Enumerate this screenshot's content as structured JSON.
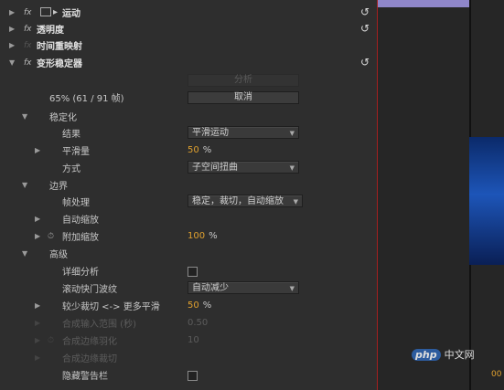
{
  "effects": {
    "motion": {
      "label": "运动"
    },
    "opacity": {
      "label": "透明度"
    },
    "time_remap": {
      "label": "时间重映射"
    },
    "warp": {
      "label": "变形稳定器"
    }
  },
  "warp": {
    "analyze_label": "分析",
    "status_text": "65% (61 / 91 帧)",
    "cancel_label": "取消",
    "stabilization": {
      "label": "稳定化",
      "result_label": "结果",
      "result_value": "平滑运动",
      "smoothness_label": "平滑量",
      "smoothness_value": "50",
      "smoothness_unit": "%",
      "method_label": "方式",
      "method_value": "子空间扭曲"
    },
    "borders": {
      "label": "边界",
      "framing_label": "帧处理",
      "framing_value": "稳定，裁切，自动缩放",
      "auto_scale_label": "自动缩放",
      "additional_scale_label": "附加缩放",
      "additional_scale_value": "100",
      "additional_scale_unit": "%"
    },
    "advanced": {
      "label": "高级",
      "detailed_analysis_label": "详细分析",
      "rolling_shutter_label": "滚动快门波纹",
      "rolling_shutter_value": "自动减少",
      "crop_less_label": "较少裁切 <-> 更多平滑",
      "crop_less_value": "50",
      "crop_less_unit": "%",
      "synth_input_label": "合成输入范围 (秒)",
      "synth_input_value": "0.50",
      "synth_feather_label": "合成边缘羽化",
      "synth_feather_value": "10",
      "synth_crop_label": "合成边缘裁切",
      "hide_warning_label": "隐藏警告栏"
    }
  },
  "right_pane": {
    "timecode": "00"
  },
  "watermark": {
    "logo": "php",
    "text": "中文网"
  },
  "icons": {
    "expand": "triangle-right",
    "collapse": "triangle-down",
    "reset": "reset-arrow-icon",
    "dropdown": "chevron-down-icon"
  }
}
